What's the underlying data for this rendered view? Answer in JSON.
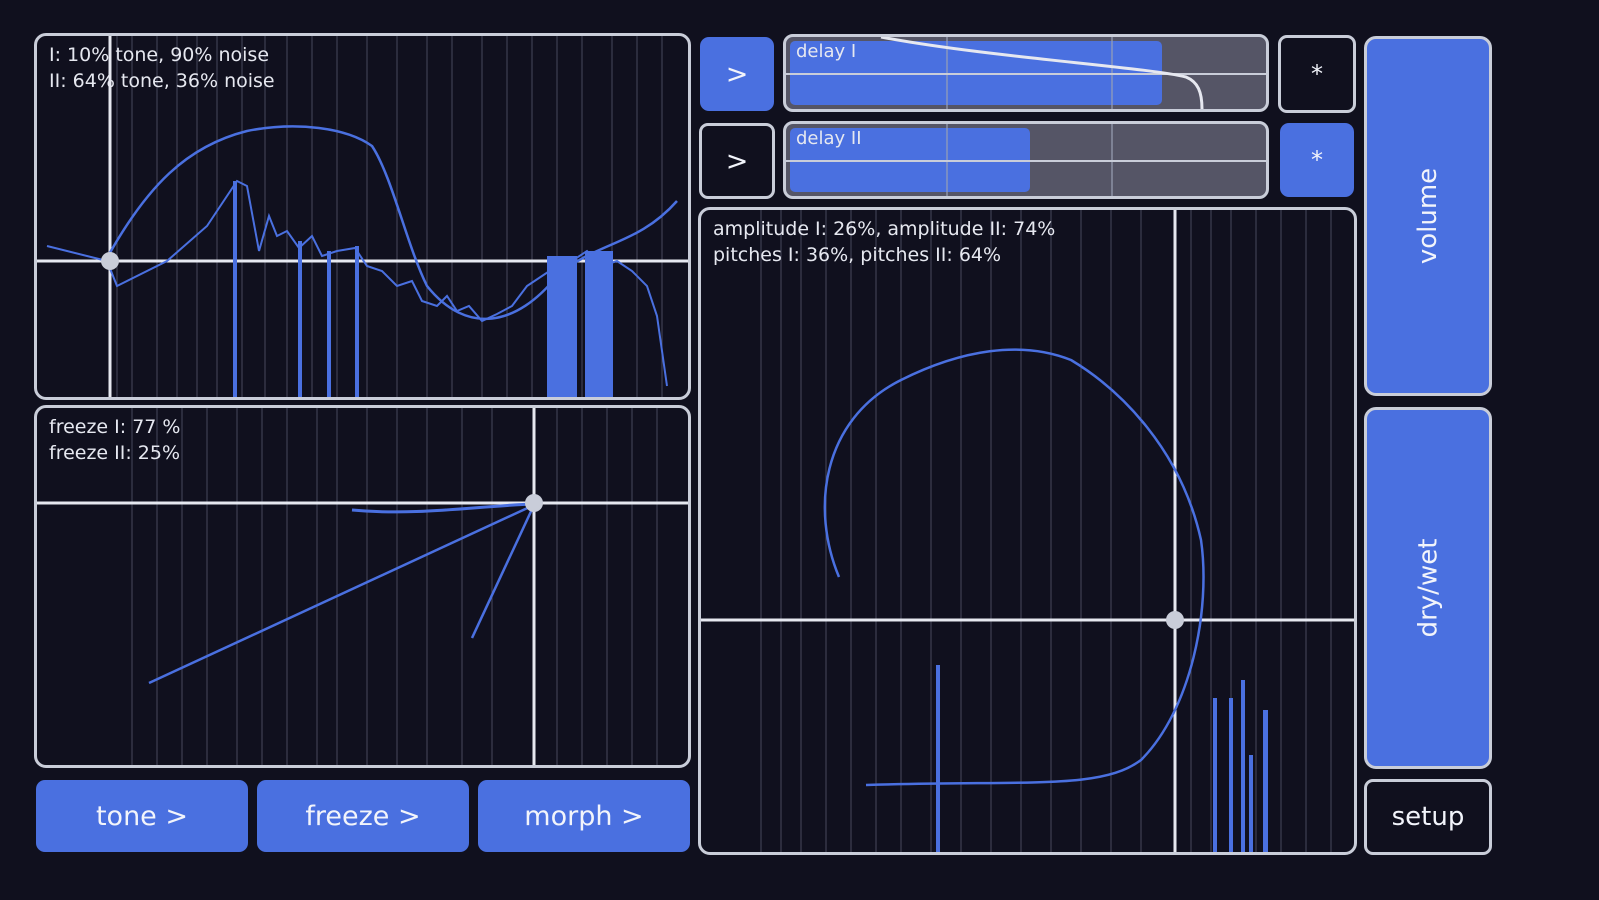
{
  "panels": {
    "tone": {
      "line1": "I: 10% tone, 90% noise",
      "line2": "II: 64% tone, 36% noise"
    },
    "freeze": {
      "line1": "freeze I: 77 %",
      "line2": "freeze II: 25%"
    },
    "morph": {
      "line1": "amplitude I: 26%, amplitude II: 74%",
      "line2": "pitches I: 36%, pitches II: 64%"
    }
  },
  "buttons": {
    "tone": "tone >",
    "freeze": "freeze >",
    "morph": "morph >",
    "setup": "setup",
    "volume": "volume",
    "drywet": "dry/wet"
  },
  "delays": [
    {
      "label": "delay I",
      "arrow": ">",
      "mark": "*",
      "fill": 0.78,
      "active": true
    },
    {
      "label": "delay II",
      "arrow": ">",
      "mark": "*",
      "fill": 0.5,
      "active": false
    }
  ],
  "colors": {
    "accent": "#4a70e0",
    "background": "#10101e",
    "border": "#c9cdd9",
    "track": "#555566"
  }
}
